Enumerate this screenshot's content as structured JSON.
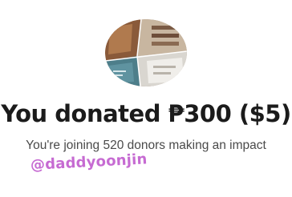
{
  "donation": {
    "headline": "You donated ₱300 ($5)",
    "subline": "You're joining 520 donors making an impact"
  },
  "watermark": {
    "text": "@daddyoonjin"
  },
  "colors": {
    "headline": "#1b1b1b",
    "subline": "#4a4a4a",
    "watermark": "#c25fcf"
  }
}
